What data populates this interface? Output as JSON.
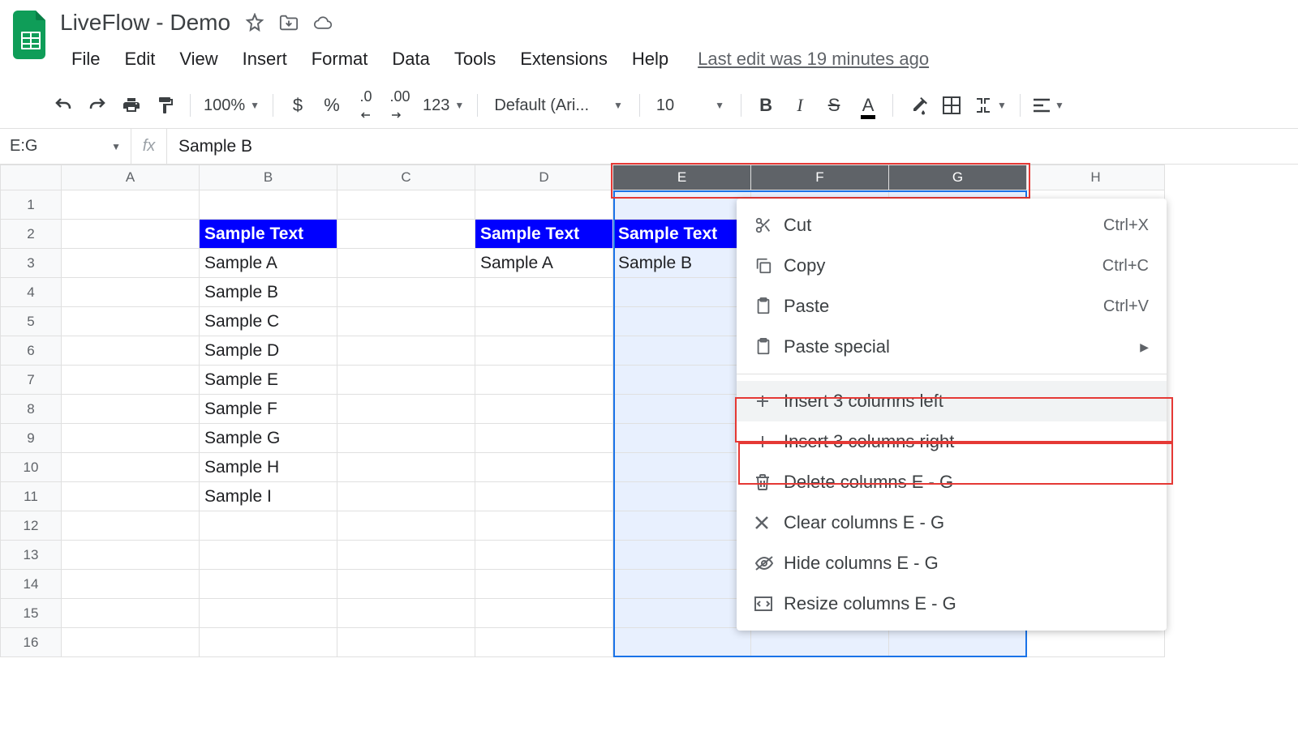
{
  "title": "LiveFlow - Demo",
  "last_edit": "Last edit was 19 minutes ago",
  "menu": [
    "File",
    "Edit",
    "View",
    "Insert",
    "Format",
    "Data",
    "Tools",
    "Extensions",
    "Help"
  ],
  "toolbar": {
    "zoom": "100%",
    "font": "Default (Ari...",
    "fontsize": "10",
    "number_format": "123"
  },
  "namebox": "E:G",
  "fx": "fx",
  "formula": "Sample B",
  "columns": [
    "A",
    "B",
    "C",
    "D",
    "E",
    "F",
    "G",
    "H"
  ],
  "rows": [
    "1",
    "2",
    "3",
    "4",
    "5",
    "6",
    "7",
    "8",
    "9",
    "10",
    "11",
    "12",
    "13",
    "14",
    "15",
    "16"
  ],
  "cells": {
    "B2": "Sample Text",
    "D2": "Sample Text",
    "E2": "Sample Text",
    "B3": "Sample A",
    "D3": "Sample A",
    "E3": "Sample B",
    "B4": "Sample B",
    "B5": "Sample C",
    "B6": "Sample D",
    "B7": "Sample E",
    "B8": "Sample F",
    "B9": "Sample G",
    "B10": "Sample H",
    "B11": "Sample I"
  },
  "context_menu": {
    "cut": {
      "label": "Cut",
      "shortcut": "Ctrl+X"
    },
    "copy": {
      "label": "Copy",
      "shortcut": "Ctrl+C"
    },
    "paste": {
      "label": "Paste",
      "shortcut": "Ctrl+V"
    },
    "paste_special": {
      "label": "Paste special"
    },
    "insert_left": {
      "label": "Insert 3 columns left"
    },
    "insert_right": {
      "label": "Insert 3 columns right"
    },
    "delete": {
      "label": "Delete columns E - G"
    },
    "clear": {
      "label": "Clear columns E - G"
    },
    "hide": {
      "label": "Hide columns E - G"
    },
    "resize": {
      "label": "Resize columns E - G"
    }
  }
}
